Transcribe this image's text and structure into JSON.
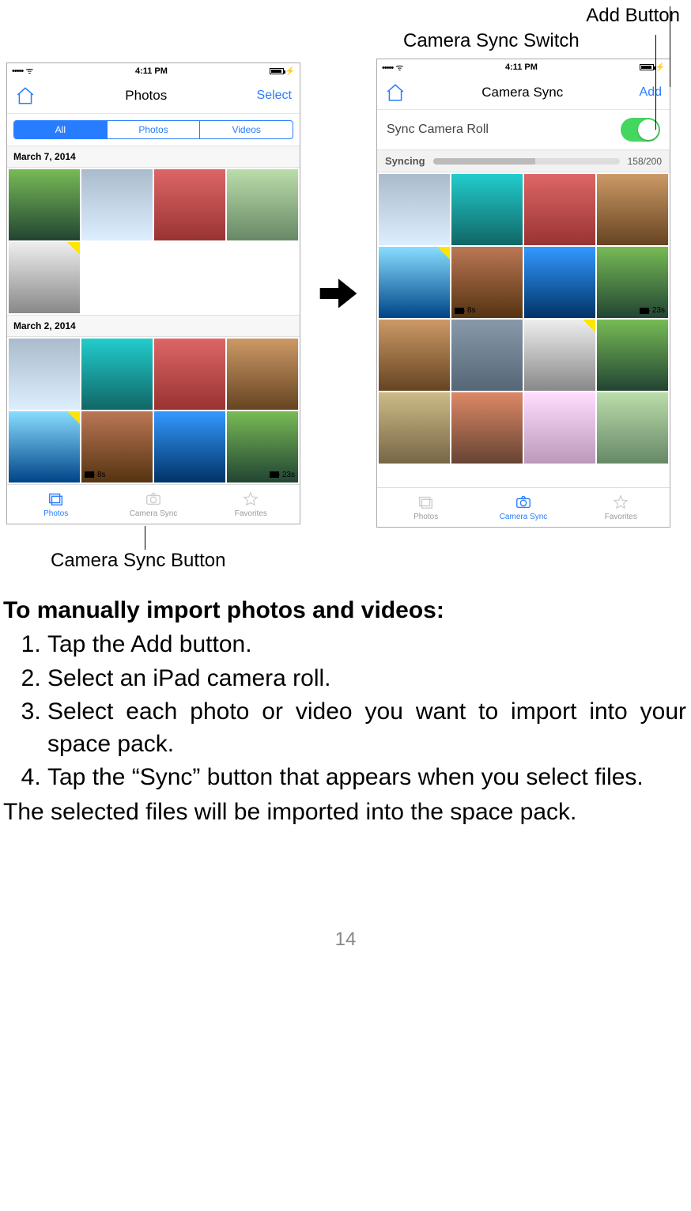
{
  "callouts": {
    "add_button": "Add Button",
    "camera_sync_switch": "Camera Sync Switch",
    "camera_sync_button": "Camera Sync Button"
  },
  "statusbar": {
    "signal": "•••••",
    "wifi": "✓",
    "time": "4:11 PM"
  },
  "phone_left": {
    "title": "Photos",
    "select": "Select",
    "segments": {
      "all": "All",
      "photos": "Photos",
      "videos": "Videos"
    },
    "sections": [
      {
        "label": "March 7, 2014"
      },
      {
        "label": "March 2, 2014"
      }
    ],
    "videos": {
      "v1": "8s",
      "v2": "23s"
    }
  },
  "phone_right": {
    "title": "Camera Sync",
    "add": "Add",
    "sync_row_label": "Sync Camera Roll",
    "syncing_label": "Syncing",
    "sync_count": "158/200",
    "videos": {
      "v1": "8s",
      "v2": "23s"
    }
  },
  "tabs": {
    "photos": "Photos",
    "camera_sync": "Camera Sync",
    "favorites": "Favorites"
  },
  "instructions": {
    "heading": "To manually import photos and videos:",
    "steps": [
      "Tap the Add button.",
      "Select an iPad camera roll.",
      "Select each photo or video you want to import into your space pack.",
      "Tap the “Sync” button that appears when you select files."
    ],
    "after": "The selected files will be imported into the space pack."
  },
  "page_number": "14"
}
